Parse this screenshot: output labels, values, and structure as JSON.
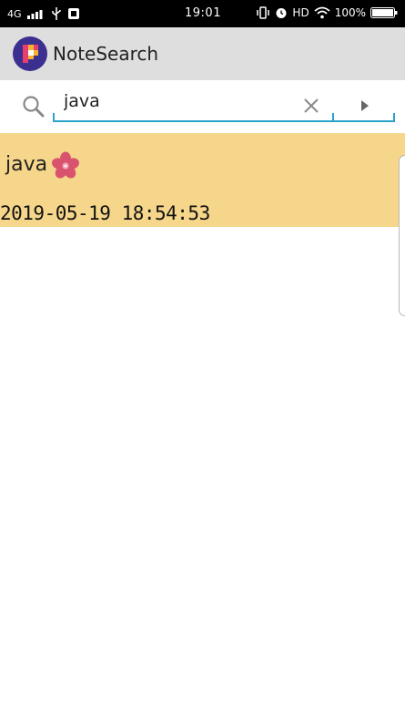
{
  "status_bar": {
    "network": "4G",
    "time": "19:01",
    "hd": "HD",
    "battery": "100%"
  },
  "app": {
    "title": "NoteSearch",
    "logo_icon": "notesearch-logo-icon"
  },
  "search": {
    "value": "java",
    "placeholder": "",
    "search_icon": "magnifier-icon",
    "clear_icon": "close-icon",
    "submit_icon": "play-arrow-icon"
  },
  "results": [
    {
      "title": "java",
      "timestamp": "2019-05-19 18:54:53",
      "decoration_icon": "flower-icon"
    }
  ],
  "colors": {
    "status_bar": "#000000",
    "app_bar": "#dedede",
    "accent": "#2aa3cc",
    "result_highlight": "#f6d68a",
    "flower": "#d9536f"
  }
}
